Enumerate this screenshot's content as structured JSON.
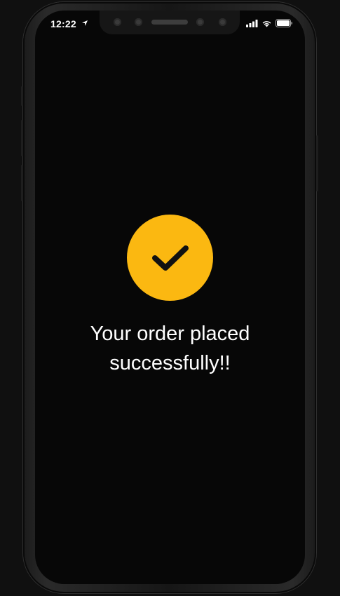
{
  "status_bar": {
    "time": "12:22",
    "icons": [
      "location-arrow-icon",
      "cellular-signal-icon",
      "wifi-icon",
      "battery-icon"
    ]
  },
  "success": {
    "icon": "checkmark-circle-icon",
    "message_line1": "Your order placed",
    "message_line2": "successfully!!"
  },
  "colors": {
    "accent": "#fbb811",
    "screen_background": "#070707",
    "text": "#ffffff"
  }
}
